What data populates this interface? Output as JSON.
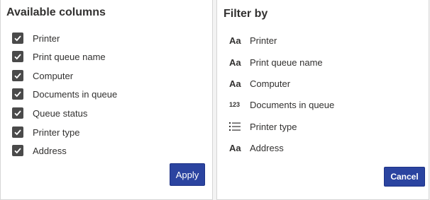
{
  "available_columns": {
    "title": "Available columns",
    "items": [
      {
        "label": "Printer",
        "checked": true
      },
      {
        "label": "Print queue name",
        "checked": true
      },
      {
        "label": "Computer",
        "checked": true
      },
      {
        "label": "Documents in queue",
        "checked": true
      },
      {
        "label": "Queue status",
        "checked": true
      },
      {
        "label": "Printer type",
        "checked": true
      },
      {
        "label": "Address",
        "checked": true
      }
    ],
    "apply_label": "Apply"
  },
  "filter_by": {
    "title": "Filter by",
    "items": [
      {
        "label": "Printer",
        "icon": "text-type-icon",
        "glyph": "Aa"
      },
      {
        "label": "Print queue name",
        "icon": "text-type-icon",
        "glyph": "Aa"
      },
      {
        "label": "Computer",
        "icon": "text-type-icon",
        "glyph": "Aa"
      },
      {
        "label": "Documents in queue",
        "icon": "number-type-icon",
        "glyph": "123"
      },
      {
        "label": "Printer type",
        "icon": "list-type-icon",
        "glyph": ""
      },
      {
        "label": "Address",
        "icon": "text-type-icon",
        "glyph": "Aa"
      }
    ],
    "cancel_label": "Cancel"
  },
  "colors": {
    "button_bg": "#2b44a0",
    "checkbox_bg": "#4a4a4a"
  }
}
